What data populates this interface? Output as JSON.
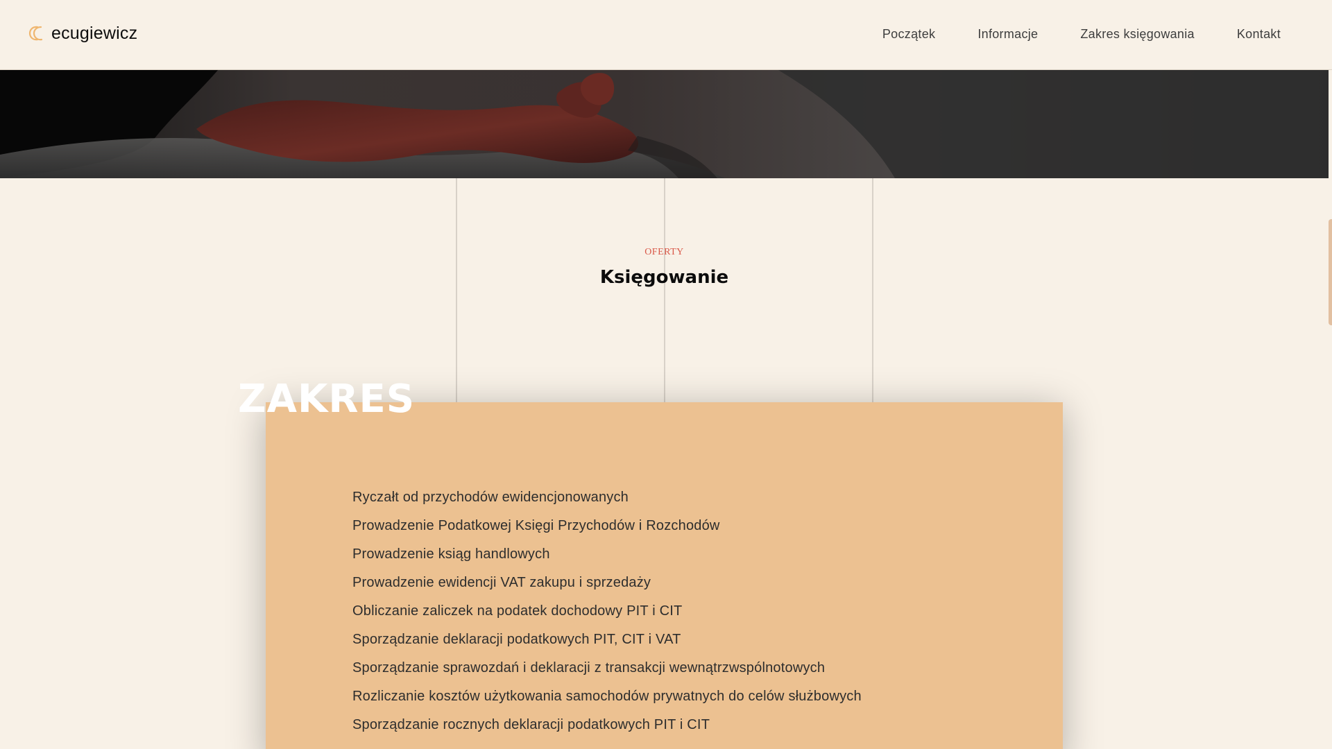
{
  "header": {
    "brand": "ecugiewicz",
    "nav": [
      "Początek",
      "Informacje",
      "Zakres księgowania",
      "Kontakt"
    ]
  },
  "section": {
    "kicker": "OFERTY",
    "title": "Księgowanie"
  },
  "scope": {
    "heading": "ZAKRES",
    "items": [
      "Ryczałt od przychodów ewidencjonowanych",
      "Prowadzenie Podatkowej Księgi Przychodów i Rozchodów",
      "Prowadzenie ksiąg handlowych",
      "Prowadzenie ewidencji VAT zakupu i sprzedaży",
      "Obliczanie zaliczek na podatek dochodowy PIT i CIT",
      "Sporządzanie deklaracji podatkowych PIT, CIT i VAT",
      "Sporządzanie sprawozdań i deklaracji z transakcji wewnątrzwspólnotowych",
      "Rozliczanie kosztów użytkowania samochodów prywatnych do celów służbowych",
      "Sporządzanie rocznych deklaracji podatkowych PIT i CIT"
    ]
  },
  "icons": {
    "logo": "interlocking-crescents-logo-icon"
  },
  "colors": {
    "background": "#f8f1e7",
    "card": "#ecc191",
    "accent": "#d95848",
    "logo_accent": "#efb66f",
    "text": "#2d2d2d"
  }
}
